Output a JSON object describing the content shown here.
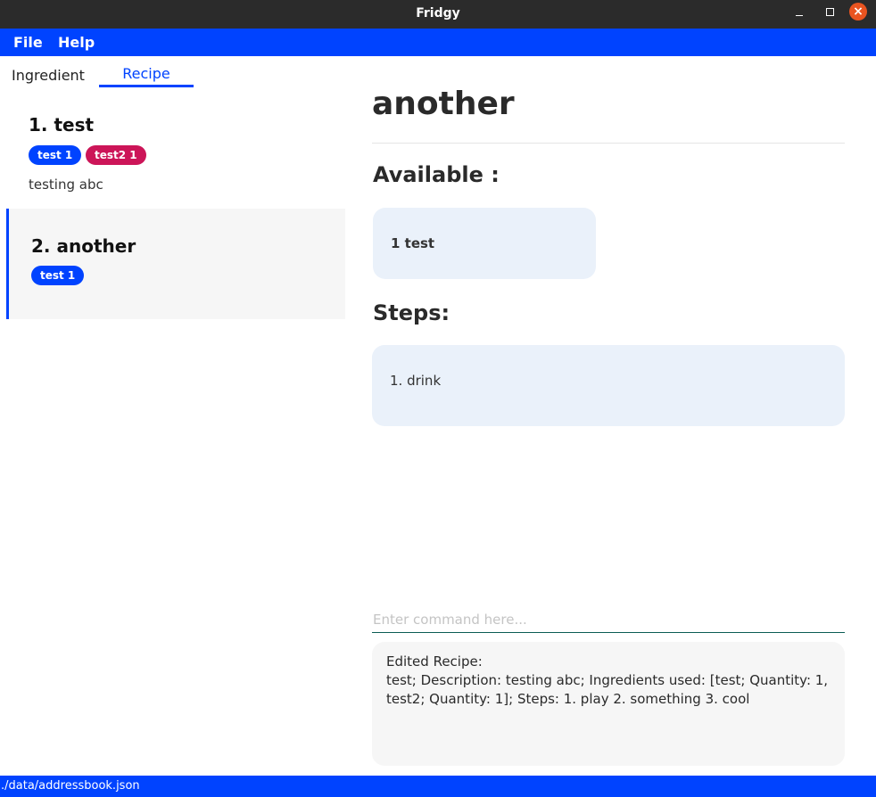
{
  "window": {
    "title": "Fridgy",
    "close_glyph": "×"
  },
  "menu": {
    "file": "File",
    "help": "Help"
  },
  "tabs": [
    {
      "label": "Ingredient",
      "selected": false
    },
    {
      "label": "Recipe",
      "selected": true
    }
  ],
  "recipes": [
    {
      "title": "1.  test",
      "tags": [
        "test 1",
        "test2 1"
      ],
      "description": "testing abc"
    },
    {
      "title": "2.  another",
      "tags": [
        "test 1"
      ],
      "description": ""
    }
  ],
  "detail": {
    "title": "another",
    "available_heading": "Available :",
    "available_item": "1 test",
    "steps_heading": "Steps:",
    "step_1": "1. drink"
  },
  "command": {
    "placeholder": "Enter command here..."
  },
  "result": {
    "text": "Edited Recipe:\ntest; Description: testing abc; Ingredients used: [test; Quantity: 1, test2; Quantity: 1]; Steps: 1. play 2. something 3. cool"
  },
  "status": {
    "path": "./data/addressbook.json"
  },
  "colors": {
    "accent": "#0043ff",
    "tag_red": "#cc1558",
    "close": "#e95420",
    "titlebar": "#2b2b2b",
    "box": "#eaf1fa"
  }
}
